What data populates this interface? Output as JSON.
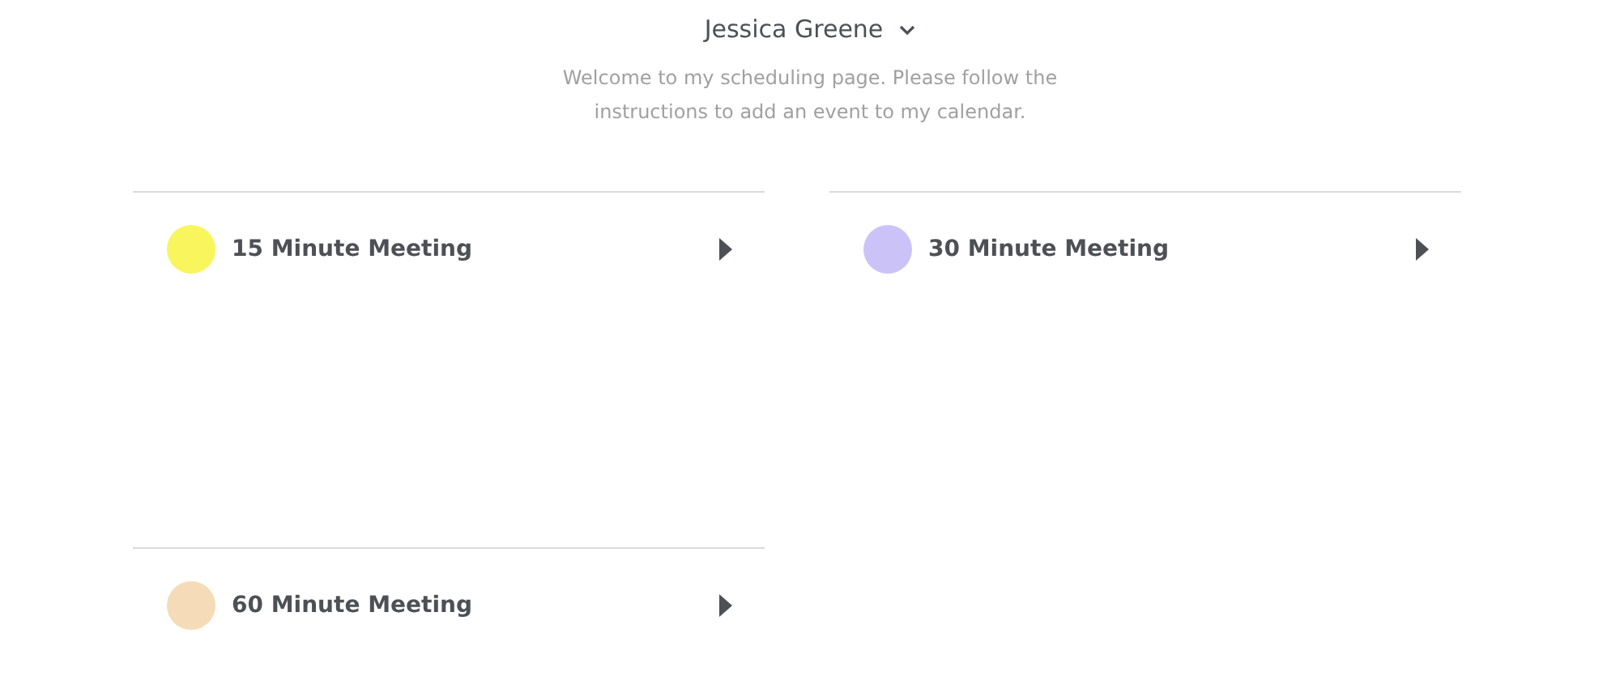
{
  "profile": {
    "name": "Jessica Greene",
    "welcome": "Welcome to my scheduling page. Please follow the instructions to add an event to my calendar."
  },
  "event_types": [
    {
      "title": "15 Minute Meeting",
      "color": "#f8f65c"
    },
    {
      "title": "30 Minute Meeting",
      "color": "#cbc3f8"
    },
    {
      "title": "60 Minute Meeting",
      "color": "#f5dbb8"
    }
  ]
}
